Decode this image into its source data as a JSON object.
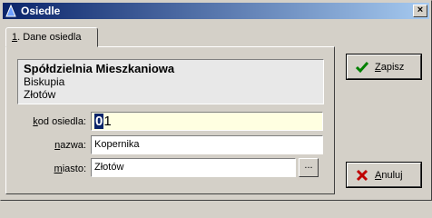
{
  "window": {
    "title": "Osiedle",
    "close_symbol": "×"
  },
  "tabs": [
    {
      "accel": "1",
      "rest": ". Dane osiedla"
    }
  ],
  "header": {
    "name": "Spółdzielnia Mieszkaniowa",
    "line2": "Biskupia",
    "line3": "Złotów"
  },
  "form": {
    "kod": {
      "label_accel": "k",
      "label_rest": "od osiedla:",
      "value_selected": "0",
      "value_rest": "1"
    },
    "nazwa": {
      "label_accel": "n",
      "label_rest": "azwa:",
      "value": "Kopernika"
    },
    "miasto": {
      "label_accel": "m",
      "label_rest": "iasto:",
      "value": "Złotów"
    },
    "browse_label": "..."
  },
  "buttons": {
    "save": {
      "accel": "Z",
      "rest": "apisz",
      "icon": "checkmark-icon",
      "color": "#008000"
    },
    "cancel": {
      "accel": "A",
      "rest": "nuluj",
      "icon": "x-icon",
      "color": "#c00000"
    }
  }
}
